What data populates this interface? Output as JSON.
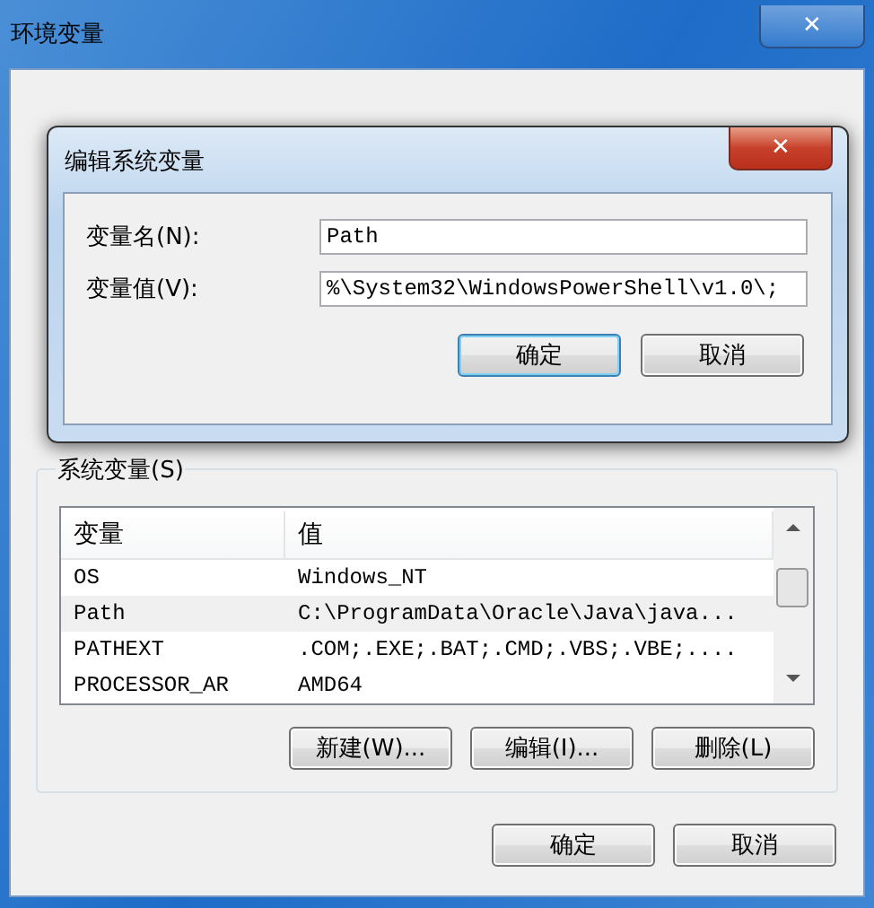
{
  "window": {
    "title": "环境变量",
    "close": "✕"
  },
  "dialog": {
    "title": "编辑系统变量",
    "close": "✕",
    "fields": [
      {
        "label": "变量名(N):",
        "value": "Path"
      },
      {
        "label": "变量值(V):",
        "value": "%\\System32\\WindowsPowerShell\\v1.0\\;"
      }
    ],
    "buttons": [
      {
        "label": "确定",
        "default": true
      },
      {
        "label": "取消",
        "default": false
      }
    ]
  },
  "system_variables": {
    "title": "系统变量(S)",
    "columns": [
      "变量",
      "值"
    ],
    "rows": [
      {
        "name": "OS",
        "value": "Windows_NT",
        "selected": false
      },
      {
        "name": "Path",
        "value": "C:\\ProgramData\\Oracle\\Java\\java...",
        "selected": true
      },
      {
        "name": "PATHEXT",
        "value": ".COM;.EXE;.BAT;.CMD;.VBS;.VBE;....",
        "selected": false
      },
      {
        "name": "PROCESSOR_AR",
        "value": "AMD64",
        "selected": false
      }
    ],
    "buttons": [
      "新建(W)...",
      "编辑(I)...",
      "删除(L)"
    ]
  },
  "buttons": [
    {
      "label": "确定",
      "default": false
    },
    {
      "label": "取消",
      "default": false
    }
  ]
}
